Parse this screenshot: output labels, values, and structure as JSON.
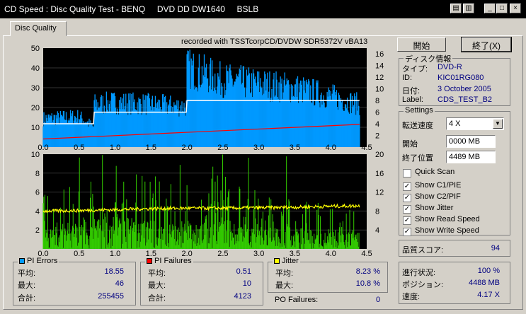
{
  "window": {
    "title": "CD Speed : Disc Quality Test - BENQ     DVD DD DW1640     BSLB"
  },
  "tabs": [
    {
      "label": "Disc Quality"
    }
  ],
  "chart_top": {
    "recorded_with": "recorded with TSSTcorpCD/DVDW SDR5372V vBA13",
    "y_left_ticks": [
      "50",
      "40",
      "30",
      "20",
      "10"
    ],
    "y_right_ticks": [
      "16",
      "14",
      "12",
      "10",
      "8",
      "6",
      "4",
      "2"
    ],
    "x_ticks": [
      "0.0",
      "0.5",
      "1.0",
      "1.5",
      "2.0",
      "2.5",
      "3.0",
      "3.5",
      "4.0",
      "4.5"
    ]
  },
  "chart_bottom": {
    "y_left_ticks": [
      "10",
      "8",
      "6",
      "4",
      "2"
    ],
    "y_right_ticks": [
      "20",
      "16",
      "12",
      "8",
      "4"
    ],
    "x_ticks": [
      "0.0",
      "0.5",
      "1.0",
      "1.5",
      "2.0",
      "2.5",
      "3.0",
      "3.5",
      "4.0",
      "4.5"
    ]
  },
  "chart_data": [
    {
      "type": "area",
      "series": [
        {
          "name": "PI Errors",
          "x": [
            0.0,
            0.5,
            0.7,
            0.71,
            1.0,
            1.5,
            1.99,
            2.0,
            2.5,
            3.0,
            3.5,
            4.0,
            4.4
          ],
          "y": [
            14,
            15,
            10,
            21,
            22,
            21,
            20,
            39,
            33,
            31,
            29,
            25,
            21
          ]
        },
        {
          "name": "Read Speed",
          "x": [
            0.0,
            0.7,
            0.71,
            1.99,
            2.0,
            4.4
          ],
          "y": [
            4.0,
            4.0,
            6.0,
            6.0,
            8.0,
            8.0
          ]
        },
        {
          "name": "Write Speed",
          "x": [
            0.0,
            4.4
          ],
          "y": [
            1.4,
            3.9
          ]
        }
      ],
      "xlim": [
        0.0,
        4.5
      ],
      "ylim": [
        0,
        50
      ],
      "y2lim": [
        0,
        17
      ]
    },
    {
      "type": "bar",
      "series": [
        {
          "name": "PI Failures",
          "x": [
            0.0,
            0.5,
            1.0,
            1.5,
            2.0,
            2.5,
            3.0,
            3.5,
            4.0,
            4.4
          ],
          "y": [
            4,
            5,
            6,
            5,
            5,
            5,
            4,
            4,
            3,
            3
          ]
        },
        {
          "name": "Jitter",
          "x": [
            0.0,
            0.5,
            1.0,
            1.5,
            2.0,
            2.5,
            3.0,
            3.5,
            4.0,
            4.4
          ],
          "y": [
            8.0,
            8.1,
            8.3,
            8.5,
            8.6,
            8.6,
            8.7,
            8.8,
            9.0,
            9.1
          ]
        }
      ],
      "xlim": [
        0.0,
        4.5
      ],
      "ylim": [
        0,
        10
      ],
      "y2lim": [
        0,
        20
      ]
    }
  ],
  "buttons": {
    "start": "開始",
    "stop": "終了(X)"
  },
  "disc_info": {
    "caption": "ディスク情報",
    "type_label": "タイプ:",
    "type_value": "DVD-R",
    "id_label": "ID:",
    "id_value": "KIC01RG080",
    "date_label": "日付:",
    "date_value": "3 October 2005",
    "label_label": "Label:",
    "label_value": "CDS_TEST_B2"
  },
  "settings": {
    "caption": "Settings",
    "speed_label": "転送速度",
    "speed_value": "4 X",
    "start_label": "開始",
    "start_value": "0000 MB",
    "end_label": "終了位置",
    "end_value": "4489 MB",
    "quick_scan": "Quick Scan",
    "show_c1": "Show C1/PIE",
    "show_c2": "Show C2/PIF",
    "show_jitter": "Show Jitter",
    "show_read": "Show Read Speed",
    "show_write": "Show Write Speed"
  },
  "score": {
    "label": "品質スコア:",
    "value": "94"
  },
  "progress": {
    "status_label": "進行状況:",
    "status_value": "100 %",
    "position_label": "ポジション:",
    "position_value": "4488 MB",
    "speed_label": "速度:",
    "speed_value": "4.17 X"
  },
  "pi_errors": {
    "caption": "PI Errors",
    "avg_label": "平均:",
    "avg": "18.55",
    "max_label": "最大:",
    "max": "46",
    "total_label": "合計:",
    "total": "255455"
  },
  "pi_failures": {
    "caption": "PI Failures",
    "avg_label": "平均:",
    "avg": "0.51",
    "max_label": "最大:",
    "max": "10",
    "total_label": "合計:",
    "total": "4123"
  },
  "jitter": {
    "caption": "Jitter",
    "avg_label": "平均:",
    "avg": "8.23 %",
    "max_label": "最大:",
    "max": "10.8 %"
  },
  "po_failures": {
    "label": "PO Failures:",
    "value": "0"
  },
  "colors": {
    "pie": "#0099ff",
    "pif": "#33cc00",
    "jitter": "#ffff00",
    "read": "#ffffff",
    "write": "#ff0000"
  }
}
